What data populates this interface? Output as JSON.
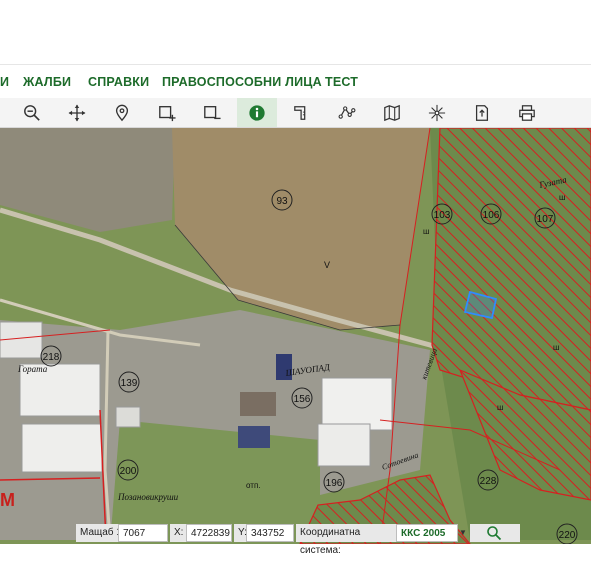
{
  "menu": {
    "items": [
      {
        "label": "И"
      },
      {
        "label": "ЖАЛБИ"
      },
      {
        "label": "СПРАВКИ"
      },
      {
        "label": "ПРАВОСПОСОБНИ ЛИЦА"
      },
      {
        "label": "ТЕСТ"
      }
    ]
  },
  "toolbar": {
    "tools": [
      {
        "icon": "zoom-out-icon"
      },
      {
        "icon": "pan-icon"
      },
      {
        "icon": "location-pin-icon"
      },
      {
        "icon": "zoom-box-in-icon"
      },
      {
        "icon": "zoom-box-out-icon"
      },
      {
        "icon": "info-icon",
        "active": true
      },
      {
        "icon": "measure-distance-icon"
      },
      {
        "icon": "measure-area-icon"
      },
      {
        "icon": "map-icon"
      },
      {
        "icon": "coordinates-icon"
      },
      {
        "icon": "export-icon"
      },
      {
        "icon": "print-icon"
      }
    ]
  },
  "map": {
    "parcels": [
      "93",
      "103",
      "106",
      "107",
      "218",
      "139",
      "156",
      "200",
      "196",
      "228",
      "220"
    ],
    "labels": {
      "v": "V",
      "sh": "ш",
      "otp": "отп.",
      "gorata": "Гората",
      "gumata": "Гузата",
      "pozanovi": "Позановикруши",
      "sotoe": "Сотоевина",
      "shoplad": "ШАУОПАД",
      "kitenitsa": "китевица",
      "m": "М"
    },
    "colors": {
      "hatch": "#d62020",
      "selection": "#2f8cff"
    }
  },
  "statusbar": {
    "scale_label": "Мащаб 1:",
    "scale_value": "7067",
    "x_label": "X:",
    "x_value": "4722839",
    "y_label": "Y:",
    "y_value": "343752",
    "crs_label": "Координатна система:",
    "crs_value": "ККС 2005",
    "crs_caret": "▼"
  }
}
